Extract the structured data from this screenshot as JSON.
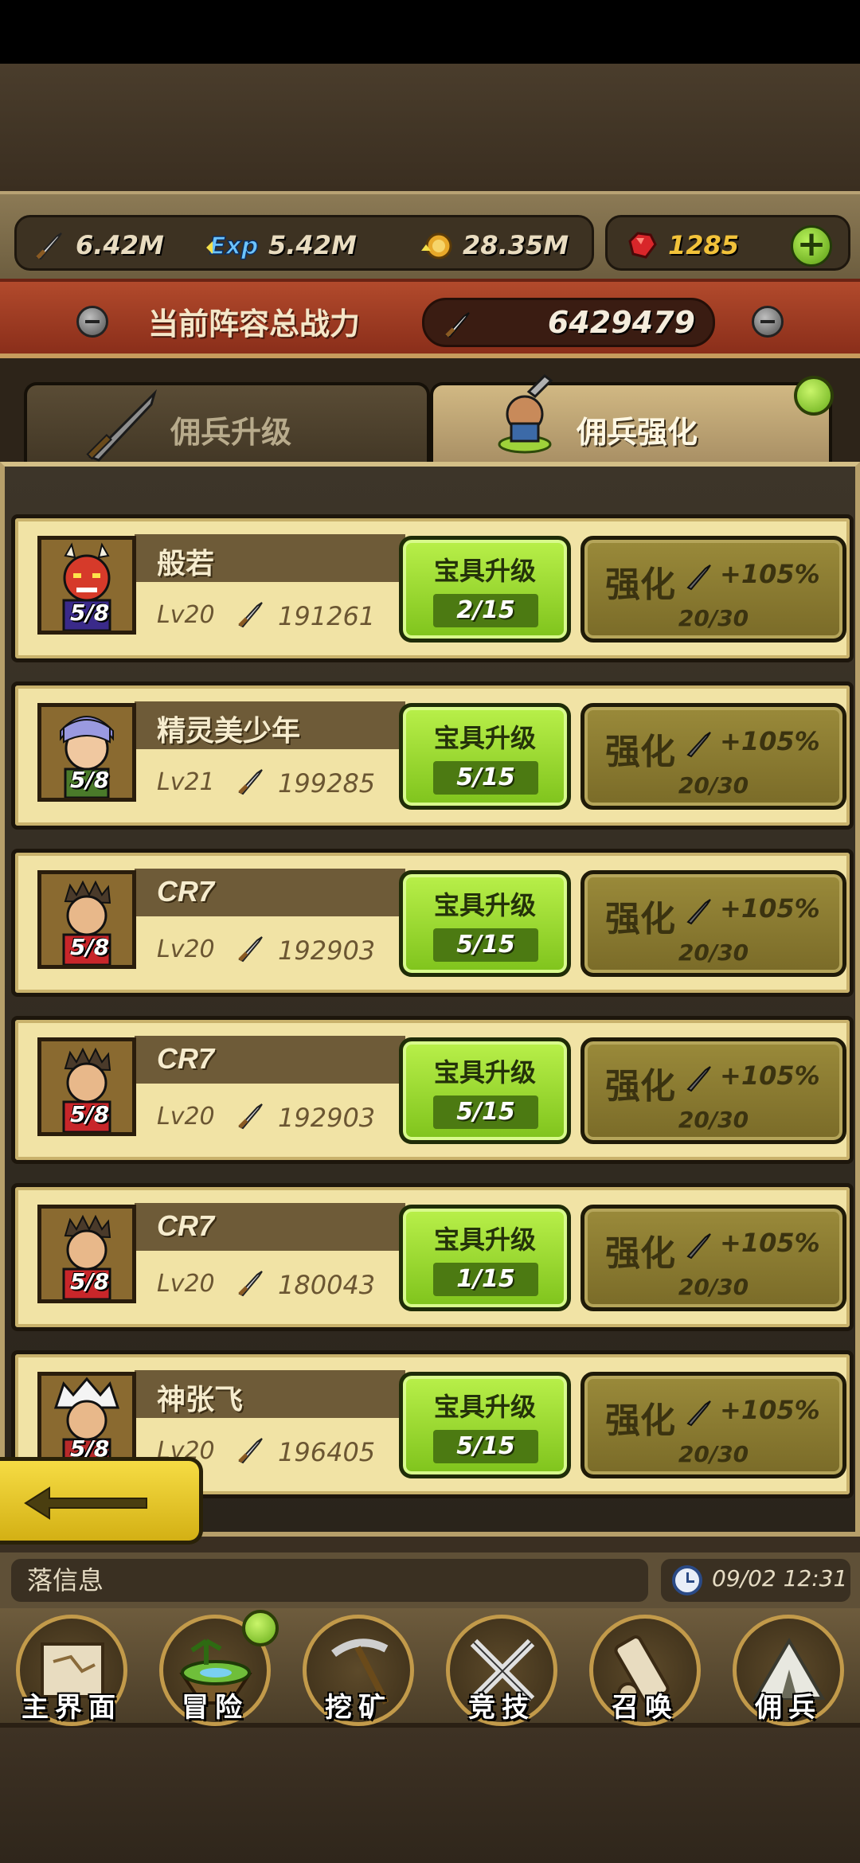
{
  "resources": {
    "attack": "6.42M",
    "exp": "5.42M",
    "gold": "28.35M",
    "gems": "1285"
  },
  "power": {
    "label": "当前阵容总战力",
    "value": "6429479"
  },
  "tabs": [
    {
      "label": "佣兵升级",
      "active": false
    },
    {
      "label": "佣兵强化",
      "active": true
    }
  ],
  "heroes": [
    {
      "name": "般若",
      "count": "5/8",
      "level": "Lv20",
      "power": "191261",
      "treasure_label": "宝具升级",
      "treasure_progress": "2/15",
      "enhance_label": "强化",
      "enhance_bonus": "+105%",
      "enhance_progress": "20/30",
      "portrait": "oni"
    },
    {
      "name": "精灵美少年",
      "count": "5/8",
      "level": "Lv21",
      "power": "199285",
      "treasure_label": "宝具升级",
      "treasure_progress": "5/15",
      "enhance_label": "强化",
      "enhance_bonus": "+105%",
      "enhance_progress": "20/30",
      "portrait": "elf"
    },
    {
      "name": "CR7",
      "count": "5/8",
      "level": "Lv20",
      "power": "192903",
      "treasure_label": "宝具升级",
      "treasure_progress": "5/15",
      "enhance_label": "强化",
      "enhance_bonus": "+105%",
      "enhance_progress": "20/30",
      "portrait": "cr7"
    },
    {
      "name": "CR7",
      "count": "5/8",
      "level": "Lv20",
      "power": "192903",
      "treasure_label": "宝具升级",
      "treasure_progress": "5/15",
      "enhance_label": "强化",
      "enhance_bonus": "+105%",
      "enhance_progress": "20/30",
      "portrait": "cr7"
    },
    {
      "name": "CR7",
      "count": "5/8",
      "level": "Lv20",
      "power": "180043",
      "treasure_label": "宝具升级",
      "treasure_progress": "1/15",
      "enhance_label": "强化",
      "enhance_bonus": "+105%",
      "enhance_progress": "20/30",
      "portrait": "cr7"
    },
    {
      "name": "神张飞",
      "count": "5/8",
      "level": "Lv20",
      "power": "196405",
      "treasure_label": "宝具升级",
      "treasure_progress": "5/15",
      "enhance_label": "强化",
      "enhance_bonus": "+105%",
      "enhance_progress": "20/30",
      "portrait": "zhangfei"
    }
  ],
  "info": {
    "message": "落信息",
    "datetime": "09/02 12:31"
  },
  "nav": [
    {
      "label": "主界面",
      "icon": "scroll-map-icon",
      "badge": false
    },
    {
      "label": "冒险",
      "icon": "floating-island-icon",
      "badge": true
    },
    {
      "label": "挖矿",
      "icon": "pickaxe-icon",
      "badge": false
    },
    {
      "label": "竞技",
      "icon": "crossed-swords-icon",
      "badge": false
    },
    {
      "label": "召唤",
      "icon": "summon-scroll-icon",
      "badge": false
    },
    {
      "label": "佣兵",
      "icon": "tent-icon",
      "badge": false
    }
  ],
  "colors": {
    "treasure_button": "#9ddc32",
    "enhance_button": "#8a7a30",
    "row_background": "#f1e3a5",
    "power_banner": "#a63f24"
  }
}
